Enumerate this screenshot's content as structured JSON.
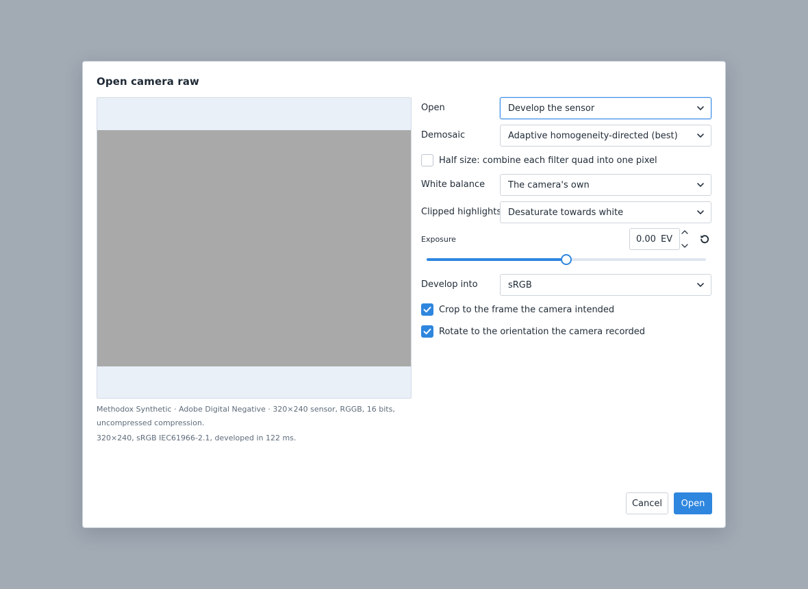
{
  "dialog": {
    "title": "Open camera raw"
  },
  "preview": {
    "info_line1": "Methodox Synthetic · Adobe Digital Negative · 320×240 sensor, RGGB, 16 bits, uncompressed compression.",
    "info_line2": "320×240, sRGB IEC61966-2.1, developed in 122 ms."
  },
  "form": {
    "open": {
      "label": "Open",
      "value": "Develop the sensor"
    },
    "demosaic": {
      "label": "Demosaic",
      "value": "Adaptive homogeneity-directed (best)"
    },
    "half_size": {
      "label": "Half size: combine each filter quad into one pixel",
      "checked": false
    },
    "white_balance": {
      "label": "White balance",
      "value": "The camera's own"
    },
    "clipped_highlights": {
      "label": "Clipped highlights",
      "value": "Desaturate towards white"
    },
    "exposure": {
      "label": "Exposure",
      "value": "0.00",
      "unit": "EV",
      "slider_fraction": 0.5
    },
    "develop_into": {
      "label": "Develop into",
      "value": "sRGB"
    },
    "crop": {
      "label": "Crop to the frame the camera intended",
      "checked": true
    },
    "rotate": {
      "label": "Rotate to the orientation the camera recorded",
      "checked": true
    }
  },
  "buttons": {
    "cancel": "Cancel",
    "open": "Open"
  },
  "icons": {
    "select_arrow": "chevron-down-icon",
    "spin_up": "chevron-up-icon",
    "spin_down": "chevron-down-icon",
    "reset": "reset-icon",
    "check": "check-icon"
  },
  "colors": {
    "accent": "#2e86de",
    "backdrop": "#a2aab4",
    "preview_bg": "#e9f0f8",
    "preview_image": "#a9a9a9"
  }
}
